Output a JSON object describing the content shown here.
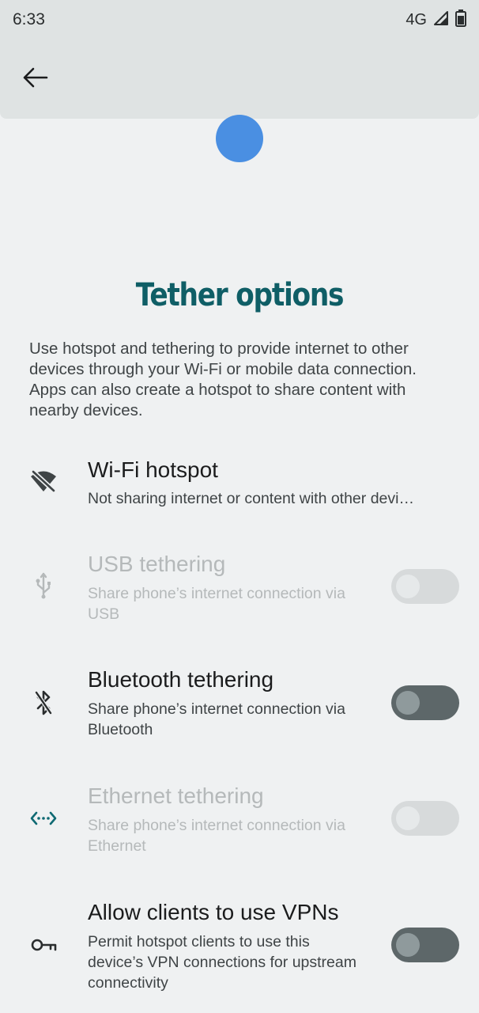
{
  "status_bar": {
    "time": "6:33",
    "network": "4G"
  },
  "app_bar": {
    "back_icon": "arrow-back-icon"
  },
  "page": {
    "title": "Tether options",
    "description": "Use hotspot and tethering to provide internet to other devices through your Wi-Fi or mobile data connection. Apps can also create a hotspot to share content with nearby devices."
  },
  "settings": [
    {
      "icon": "wifi-off-icon",
      "title": "Wi-Fi hotspot",
      "summary": "Not sharing internet or content with other devi…",
      "enabled": true,
      "has_toggle": false
    },
    {
      "icon": "usb-icon",
      "title": "USB tethering",
      "summary": "Share phone’s internet connection via USB",
      "enabled": false,
      "has_toggle": true,
      "toggle_on": false
    },
    {
      "icon": "bluetooth-icon",
      "title": "Bluetooth tethering",
      "summary": "Share phone’s internet connection via Bluetooth",
      "enabled": true,
      "has_toggle": true,
      "toggle_on": false
    },
    {
      "icon": "ethernet-icon",
      "title": "Ethernet tethering",
      "summary": "Share phone’s internet connection via Ethernet",
      "enabled": false,
      "has_toggle": true,
      "toggle_on": false
    },
    {
      "icon": "vpn-key-icon",
      "title": "Allow clients to use VPNs",
      "summary": "Permit hotspot clients to use this device’s VPN connections for upstream connectivity",
      "enabled": true,
      "has_toggle": true,
      "toggle_on": false
    }
  ],
  "colors": {
    "background": "#eff1f2",
    "app_bar": "#dfe3e3",
    "title": "#0f5e66",
    "hero_circle": "#4a8fe2",
    "toggle_track_off": "#5d6769",
    "disabled_text": "#b5b9ba"
  }
}
